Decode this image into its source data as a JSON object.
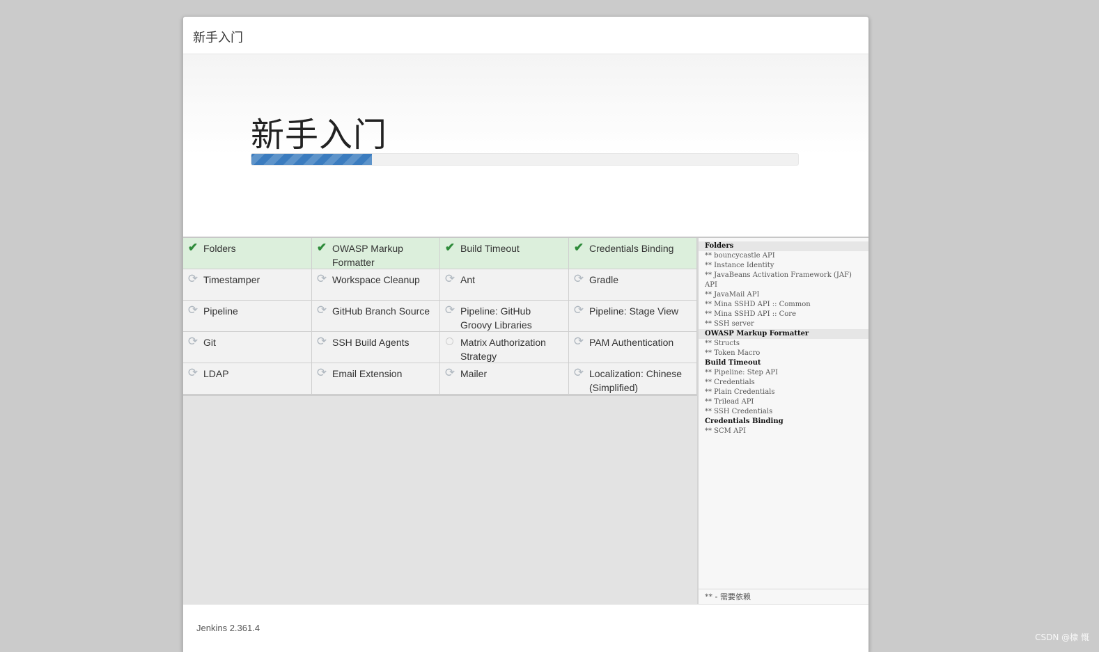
{
  "dialog": {
    "title": "新手入门",
    "hero_title": "新手入门",
    "progress_fraction": 0.22
  },
  "plugins": [
    {
      "name": "Folders",
      "status": "success"
    },
    {
      "name": "OWASP Markup Formatter",
      "status": "success"
    },
    {
      "name": "Build Timeout",
      "status": "success"
    },
    {
      "name": "Credentials Binding",
      "status": "success"
    },
    {
      "name": "Timestamper",
      "status": "pending"
    },
    {
      "name": "Workspace Cleanup",
      "status": "pending"
    },
    {
      "name": "Ant",
      "status": "pending"
    },
    {
      "name": "Gradle",
      "status": "pending"
    },
    {
      "name": "Pipeline",
      "status": "pending"
    },
    {
      "name": "GitHub Branch Source",
      "status": "pending"
    },
    {
      "name": "Pipeline: GitHub Groovy Libraries",
      "status": "pending"
    },
    {
      "name": "Pipeline: Stage View",
      "status": "pending"
    },
    {
      "name": "Git",
      "status": "pending"
    },
    {
      "name": "SSH Build Agents",
      "status": "pending"
    },
    {
      "name": "Matrix Authorization Strategy",
      "status": "queued"
    },
    {
      "name": "PAM Authentication",
      "status": "pending"
    },
    {
      "name": "LDAP",
      "status": "pending"
    },
    {
      "name": "Email Extension",
      "status": "pending"
    },
    {
      "name": "Mailer",
      "status": "pending"
    },
    {
      "name": "Localization: Chinese (Simplified)",
      "status": "pending"
    }
  ],
  "log": {
    "lines": [
      {
        "text": "Folders",
        "kind": "header",
        "highlight": true
      },
      {
        "text": "** bouncycastle API",
        "kind": "dep"
      },
      {
        "text": "** Instance Identity",
        "kind": "dep"
      },
      {
        "text": "** JavaBeans Activation Framework (JAF) API",
        "kind": "dep"
      },
      {
        "text": "** JavaMail API",
        "kind": "dep"
      },
      {
        "text": "** Mina SSHD API :: Common",
        "kind": "dep"
      },
      {
        "text": "** Mina SSHD API :: Core",
        "kind": "dep"
      },
      {
        "text": "** SSH server",
        "kind": "dep"
      },
      {
        "text": "OWASP Markup Formatter",
        "kind": "header",
        "highlight": true
      },
      {
        "text": "** Structs",
        "kind": "dep"
      },
      {
        "text": "** Token Macro",
        "kind": "dep"
      },
      {
        "text": "Build Timeout",
        "kind": "header"
      },
      {
        "text": "** Pipeline: Step API",
        "kind": "dep"
      },
      {
        "text": "** Credentials",
        "kind": "dep"
      },
      {
        "text": "** Plain Credentials",
        "kind": "dep"
      },
      {
        "text": "** Trilead API",
        "kind": "dep"
      },
      {
        "text": "** SSH Credentials",
        "kind": "dep"
      },
      {
        "text": "Credentials Binding",
        "kind": "header"
      },
      {
        "text": "** SCM API",
        "kind": "dep"
      }
    ],
    "footer": "** - 需要依赖"
  },
  "footer": {
    "version": "Jenkins 2.361.4"
  },
  "watermark": "CSDN @棣 慨",
  "colors": {
    "success_bg": "#dcefdc",
    "success_icon": "#2e8b3a",
    "progress": "#3b7cbf"
  },
  "icons": {
    "success": "check-icon",
    "pending": "refresh-icon",
    "queued": "circle-icon"
  }
}
